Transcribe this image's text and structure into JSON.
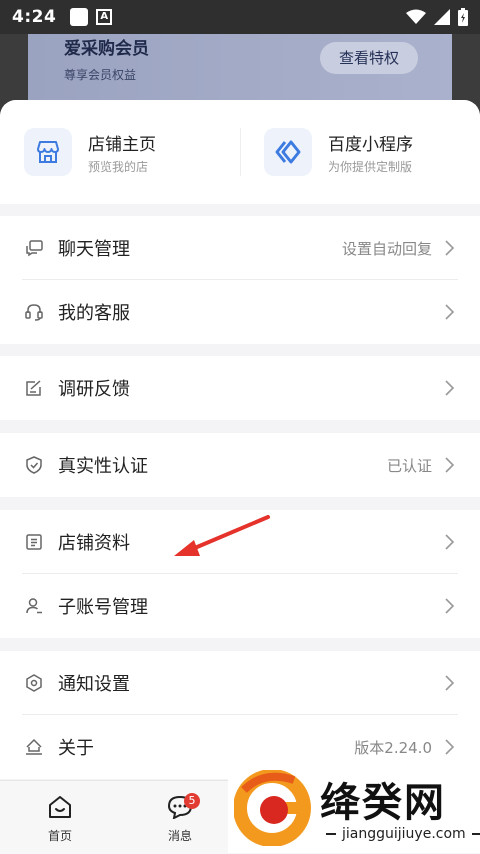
{
  "status_bar": {
    "time": "4:24"
  },
  "member_banner": {
    "title": "爱采购会员",
    "subtitle": "尊享会员权益",
    "button": "查看特权"
  },
  "top_cards": [
    {
      "title": "店铺主页",
      "subtitle": "预览我的店",
      "icon": "storefront-icon"
    },
    {
      "title": "百度小程序",
      "subtitle": "为你提供定制版",
      "icon": "mini-program-icon"
    }
  ],
  "menu": {
    "chat": {
      "label": "聊天管理",
      "value": "设置自动回复"
    },
    "service": {
      "label": "我的客服"
    },
    "feedback": {
      "label": "调研反馈"
    },
    "auth": {
      "label": "真实性认证",
      "value": "已认证"
    },
    "store_info": {
      "label": "店铺资料"
    },
    "sub_account": {
      "label": "子账号管理"
    },
    "notify": {
      "label": "通知设置"
    },
    "about": {
      "label": "关于",
      "value": "版本2.24.0"
    }
  },
  "tabbar": {
    "home": {
      "label": "首页"
    },
    "messages": {
      "label": "消息",
      "badge": "5"
    }
  },
  "watermark": {
    "main": "绛癸网",
    "sub": "jiangguijiuye.com"
  },
  "colors": {
    "accent": "#3d7be0",
    "badge": "#e23c32",
    "arrow": "#e5322a"
  }
}
